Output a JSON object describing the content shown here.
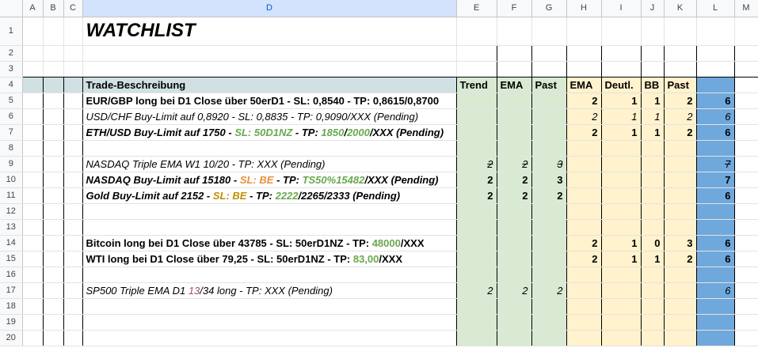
{
  "columns": [
    "A",
    "B",
    "C",
    "D",
    "E",
    "F",
    "G",
    "H",
    "I",
    "J",
    "K",
    "L",
    "M"
  ],
  "title": "WATCHLIST",
  "headers": {
    "desc": "Trade-Beschreibung",
    "trend": "Trend",
    "ema1": "EMA",
    "past1": "Past",
    "ema2": "EMA",
    "deutl": "Deutl.",
    "bb": "BB",
    "past2": "Past"
  },
  "rows": {
    "r5": {
      "d": "EUR/GBP long bei D1 Close über 50erD1 - SL: 0,8540 - TP: 0,8615/0,8700",
      "h": "2",
      "i": "1",
      "j": "1",
      "k": "2",
      "l": "6"
    },
    "r6": {
      "d": "USD/CHF Buy-Limit auf 0,8920 - SL: 0,8835 - TP: 0,9090/XXX (Pending)",
      "h": "2",
      "i": "1",
      "j": "1",
      "k": "2",
      "l": "6"
    },
    "r7": {
      "d1": "ETH/USD Buy-Limit auf 1750 - ",
      "d2": "SL: 50",
      "d3": "D1",
      "d4": "NZ",
      "d5": " - TP: ",
      "d6": "1850",
      "d7": "/",
      "d8": "2000",
      "d9": "/XXX (Pending)",
      "h": "2",
      "i": "1",
      "j": "1",
      "k": "2",
      "l": "6"
    },
    "r9": {
      "d": "NASDAQ Triple EMA W1 10/20 - TP: XXX (Pending)",
      "e": "2",
      "f": "2",
      "g": "3",
      "l": "7"
    },
    "r10": {
      "d1": "NASDAQ Buy-Limit auf 15180 - ",
      "d2": "SL: BE",
      "d3": " - TP: ",
      "d4": "TS50%15482",
      "d5": "/XXX (Pending)",
      "e": "2",
      "f": "2",
      "g": "3",
      "l": "7"
    },
    "r11": {
      "d1": "Gold Buy-Limit auf 2152 - ",
      "d2": "SL: BE",
      "d3": " - TP: ",
      "d4": "2222",
      "d5": "/2265/2333 (Pending)",
      "e": "2",
      "f": "2",
      "g": "2",
      "l": "6"
    },
    "r14": {
      "d1": "Bitcoin long bei D1 Close über 43785 - SL: 50erD1NZ - TP: ",
      "d2": "48000",
      "d3": "/XXX",
      "h": "2",
      "i": "1",
      "j": "0",
      "k": "3",
      "l": "6"
    },
    "r15": {
      "d1": "WTI long bei D1 Close über 79,25 - SL: 50erD1NZ - TP: ",
      "d2": "83,00",
      "d3": "/XXX",
      "h": "2",
      "i": "1",
      "j": "1",
      "k": "2",
      "l": "6"
    },
    "r17": {
      "d1": "SP500 Triple EMA D1 ",
      "d2": "13",
      "d3": "/34 long - TP: XXX (Pending)",
      "e": "2",
      "f": "2",
      "g": "2",
      "l": "6"
    }
  },
  "colors": {
    "green": "#d9ead3",
    "yellow": "#fff2cc",
    "blue": "#6fa8dc",
    "gray": "#d0e0e3"
  }
}
